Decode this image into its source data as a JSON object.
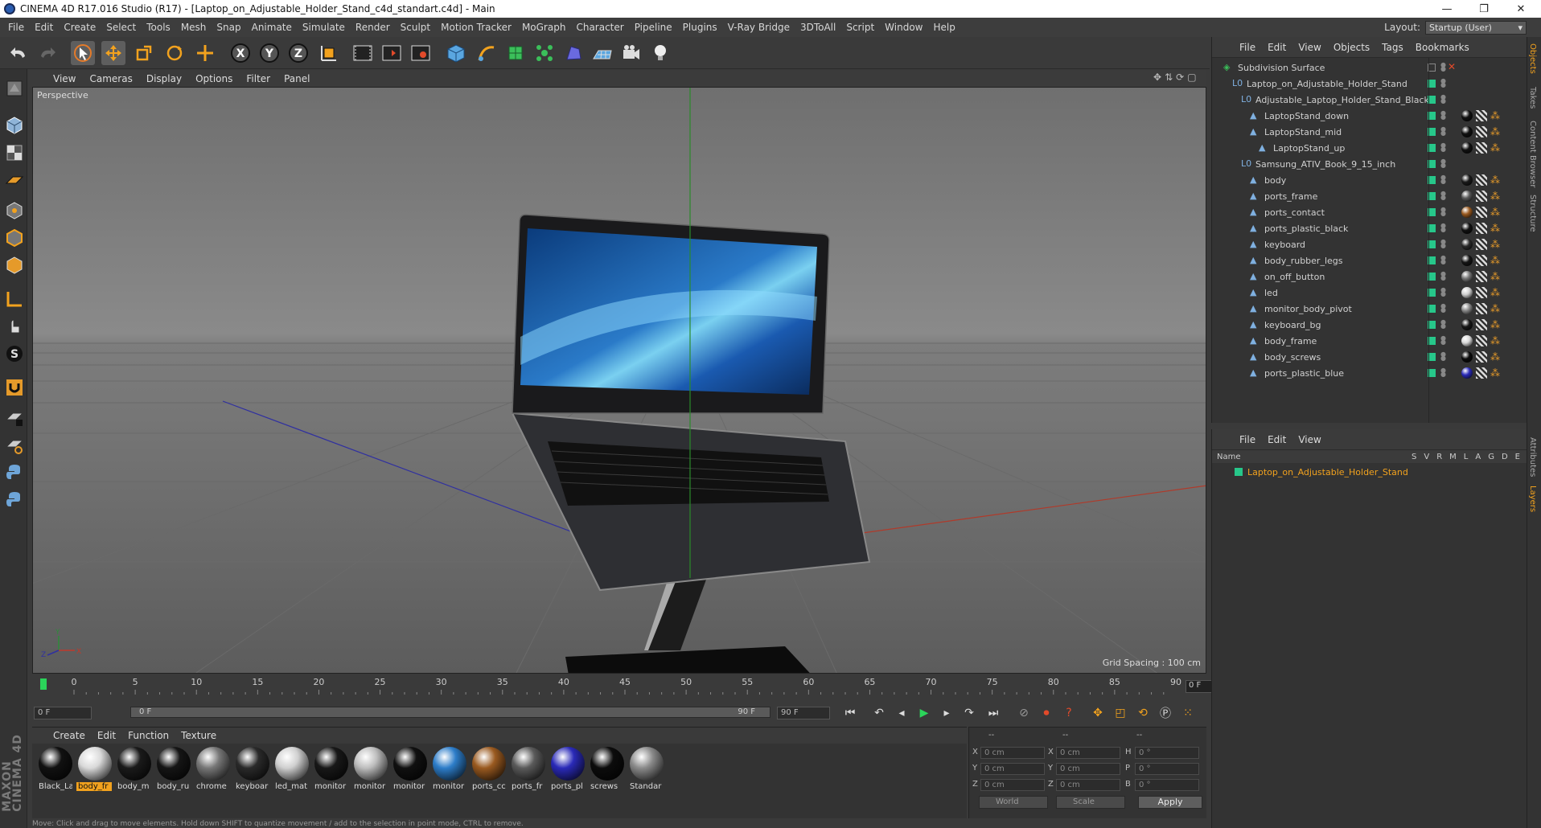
{
  "window": {
    "title": "CINEMA 4D R17.016 Studio (R17) - [Laptop_on_Adjustable_Holder_Stand_c4d_standart.c4d] - Main",
    "minimize": "—",
    "maximize": "❐",
    "close": "✕"
  },
  "menu": [
    "File",
    "Edit",
    "Create",
    "Select",
    "Tools",
    "Mesh",
    "Snap",
    "Animate",
    "Simulate",
    "Render",
    "Sculpt",
    "Motion Tracker",
    "MoGraph",
    "Character",
    "Pipeline",
    "Plugins",
    "V-Ray Bridge",
    "3DToAll",
    "Script",
    "Window",
    "Help"
  ],
  "layout": {
    "label": "Layout:",
    "value": "Startup (User)"
  },
  "viewport": {
    "menu": [
      "View",
      "Cameras",
      "Display",
      "Options",
      "Filter",
      "Panel"
    ],
    "label": "Perspective",
    "grid_spacing": "Grid Spacing : 100 cm"
  },
  "timeline": {
    "ticks": [
      "0",
      "5",
      "10",
      "15",
      "20",
      "25",
      "30",
      "35",
      "40",
      "45",
      "50",
      "55",
      "60",
      "65",
      "70",
      "75",
      "80",
      "85",
      "90"
    ],
    "frame_right": "0 F"
  },
  "transport": {
    "start_field": "0 F",
    "slider_left": "0 F",
    "slider_right": "90 F",
    "end_field": "90 F"
  },
  "materials": {
    "menu": [
      "Create",
      "Edit",
      "Function",
      "Texture"
    ],
    "items": [
      {
        "name": "Black_La",
        "color": "#111"
      },
      {
        "name": "body_fr",
        "color": "#d9d9d9",
        "selected": true
      },
      {
        "name": "body_m",
        "color": "#1a1a1a"
      },
      {
        "name": "body_ru",
        "color": "#151515"
      },
      {
        "name": "chrome",
        "color": "#777"
      },
      {
        "name": "keyboar",
        "color": "#2a2a2a"
      },
      {
        "name": "led_mat",
        "color": "#cfcfcf"
      },
      {
        "name": "monitor",
        "color": "#181818"
      },
      {
        "name": "monitor",
        "color": "#bdbdbd"
      },
      {
        "name": "monitor",
        "color": "#101010"
      },
      {
        "name": "monitor",
        "color": "#2d7dc9"
      },
      {
        "name": "ports_cc",
        "color": "#9a5a20"
      },
      {
        "name": "ports_fr",
        "color": "#5a5a5a"
      },
      {
        "name": "ports_pl",
        "color": "#2a2ab8"
      },
      {
        "name": "screws",
        "color": "#0c0c0c"
      },
      {
        "name": "Standar",
        "color": "#8a8a8a"
      }
    ]
  },
  "coords": {
    "headers": [
      "--",
      "--",
      "--"
    ],
    "rows": [
      {
        "l1": "X",
        "v1": "0 cm",
        "l2": "X",
        "v2": "0 cm",
        "l3": "H",
        "v3": "0 °"
      },
      {
        "l1": "Y",
        "v1": "0 cm",
        "l2": "Y",
        "v2": "0 cm",
        "l3": "P",
        "v3": "0 °"
      },
      {
        "l1": "Z",
        "v1": "0 cm",
        "l2": "Z",
        "v2": "0 cm",
        "l3": "B",
        "v3": "0 °"
      }
    ],
    "mode1": "World",
    "mode2": "Scale",
    "apply": "Apply"
  },
  "status": "Move: Click and drag to move elements. Hold down SHIFT to quantize movement / add to the selection in point mode, CTRL to remove.",
  "objects": {
    "menu": [
      "File",
      "Edit",
      "View",
      "Objects",
      "Tags",
      "Bookmarks"
    ],
    "rows": [
      {
        "name": "Subdivision Surface",
        "depth": 0,
        "tags": []
      },
      {
        "name": "Laptop_on_Adjustable_Holder_Stand",
        "depth": 1,
        "tags": []
      },
      {
        "name": "Adjustable_Laptop_Holder_Stand_Black",
        "depth": 2,
        "tags": []
      },
      {
        "name": "LaptopStand_down",
        "depth": 3,
        "tags": [
          "#111"
        ]
      },
      {
        "name": "LaptopStand_mid",
        "depth": 3,
        "tags": [
          "#111"
        ]
      },
      {
        "name": "LaptopStand_up",
        "depth": 4,
        "tags": [
          "#111"
        ]
      },
      {
        "name": "Samsung_ATIV_Book_9_15_inch",
        "depth": 2,
        "tags": []
      },
      {
        "name": "body",
        "depth": 3,
        "tags": [
          "#1a1a1a"
        ]
      },
      {
        "name": "ports_frame",
        "depth": 3,
        "tags": [
          "#5a5a5a"
        ]
      },
      {
        "name": "ports_contact",
        "depth": 3,
        "tags": [
          "#9a5a20"
        ]
      },
      {
        "name": "ports_plastic_black",
        "depth": 3,
        "tags": [
          "#111"
        ]
      },
      {
        "name": "keyboard",
        "depth": 3,
        "tags": [
          "#2a2a2a"
        ]
      },
      {
        "name": "body_rubber_legs",
        "depth": 3,
        "tags": [
          "#151515"
        ]
      },
      {
        "name": "on_off_button",
        "depth": 3,
        "tags": [
          "#777"
        ]
      },
      {
        "name": "led",
        "depth": 3,
        "tags": [
          "#cfcfcf"
        ]
      },
      {
        "name": "monitor_body_pivot",
        "depth": 3,
        "tags": [
          "#888"
        ]
      },
      {
        "name": "keyboard_bg",
        "depth": 3,
        "tags": [
          "#181818"
        ]
      },
      {
        "name": "body_frame",
        "depth": 3,
        "tags": [
          "#d9d9d9"
        ]
      },
      {
        "name": "body_screws",
        "depth": 3,
        "tags": [
          "#0c0c0c"
        ]
      },
      {
        "name": "ports_plastic_blue",
        "depth": 3,
        "tags": [
          "#2a2ab8"
        ]
      }
    ]
  },
  "layers": {
    "menu": [
      "File",
      "Edit",
      "View"
    ],
    "header": "Name",
    "cols": [
      "S",
      "V",
      "R",
      "M",
      "L",
      "A",
      "G",
      "D",
      "E"
    ],
    "row": "Laptop_on_Adjustable_Holder_Stand"
  },
  "side_tabs": [
    "Objects",
    "Takes",
    "Content Browser",
    "Structure",
    "Attributes",
    "Layers"
  ],
  "colors": {
    "accent": "#f2a21e",
    "green_flag": "#27c78a",
    "axis_x": "#c0392b",
    "axis_y": "#2e8b3a",
    "axis_z": "#3030a0"
  }
}
